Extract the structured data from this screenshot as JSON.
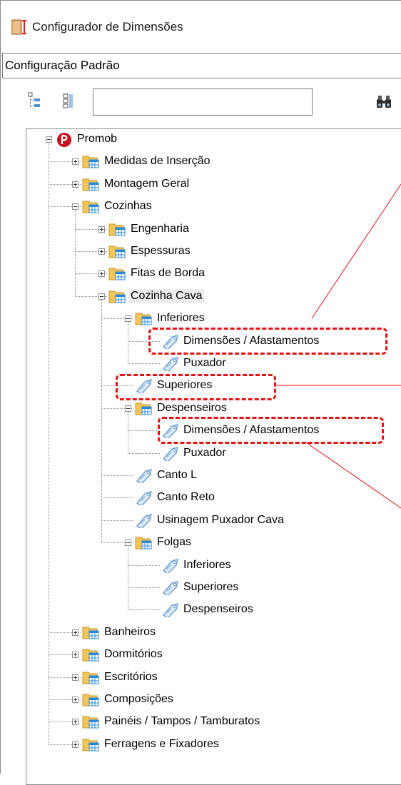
{
  "window": {
    "title": "Configurador de Dimensões",
    "app_icon": "ruler-icon"
  },
  "config": {
    "selected": "Configuração Padrão"
  },
  "toolbar": {
    "search_value": "",
    "expand_icon": "tree-expand-icon",
    "collapse_icon": "tree-collapse-icon",
    "find_icon": "binoculars-icon"
  },
  "tree": {
    "root": "Promob",
    "items": [
      "Medidas de Inserção",
      "Montagem Geral",
      "Cozinhas",
      "Engenharia",
      "Espessuras",
      "Fitas de Borda",
      "Cozinha Cava",
      "Inferiores",
      "Dimensões / Afastamentos",
      "Puxador",
      "Superiores",
      "Despenseiros",
      "Dimensões / Afastamentos",
      "Puxador",
      "Canto L",
      "Canto Reto",
      "Usinagem Puxador Cava",
      "Folgas",
      "Inferiores",
      "Superiores",
      "Despenseiros",
      "Banheiros",
      "Dormitórios",
      "Escritórios",
      "Composições",
      "Painéis / Tampos / Tamburatos",
      "Ferragens e Fixadores"
    ]
  },
  "colors": {
    "highlight": "#e81010",
    "folder": "#f2c45a",
    "table": "#2b88d8",
    "tag": "#6d9ed6",
    "root_logo": "#c8141e"
  }
}
